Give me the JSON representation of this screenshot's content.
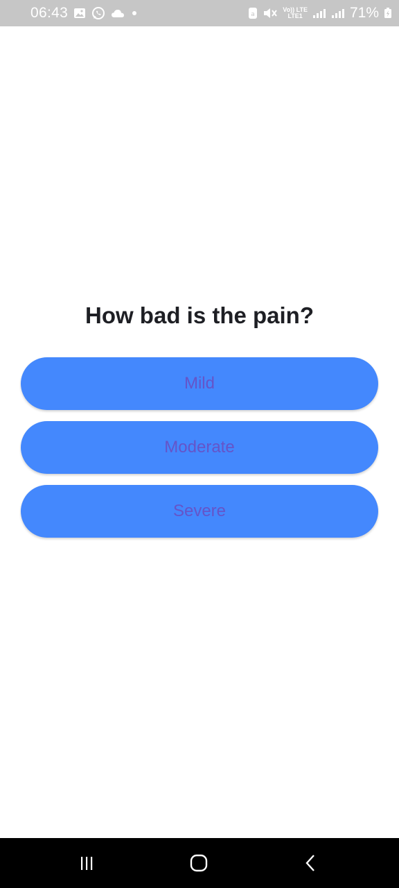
{
  "status_bar": {
    "time": "06:43",
    "net_top": "Vo)) LTE",
    "net_bottom": "LTE1",
    "battery": "71%",
    "left_icons": [
      "gallery-icon",
      "whatsapp-icon",
      "cloud-icon",
      "dot-icon"
    ],
    "right_icons": [
      "notification-icon",
      "mute-icon",
      "signal-icon",
      "signal-icon",
      "battery-icon"
    ]
  },
  "question": {
    "title": "How bad is the pain?"
  },
  "options": [
    {
      "label": "Mild"
    },
    {
      "label": "Moderate"
    },
    {
      "label": "Severe"
    }
  ],
  "nav_bar": {
    "buttons": [
      "recent-apps-icon",
      "home-icon",
      "back-icon"
    ]
  },
  "colors": {
    "button": "#4488fd",
    "button_text": "#6554c8",
    "status_bar": "#c6c6c6",
    "nav_bar": "#000000",
    "title": "#1e1f24"
  }
}
